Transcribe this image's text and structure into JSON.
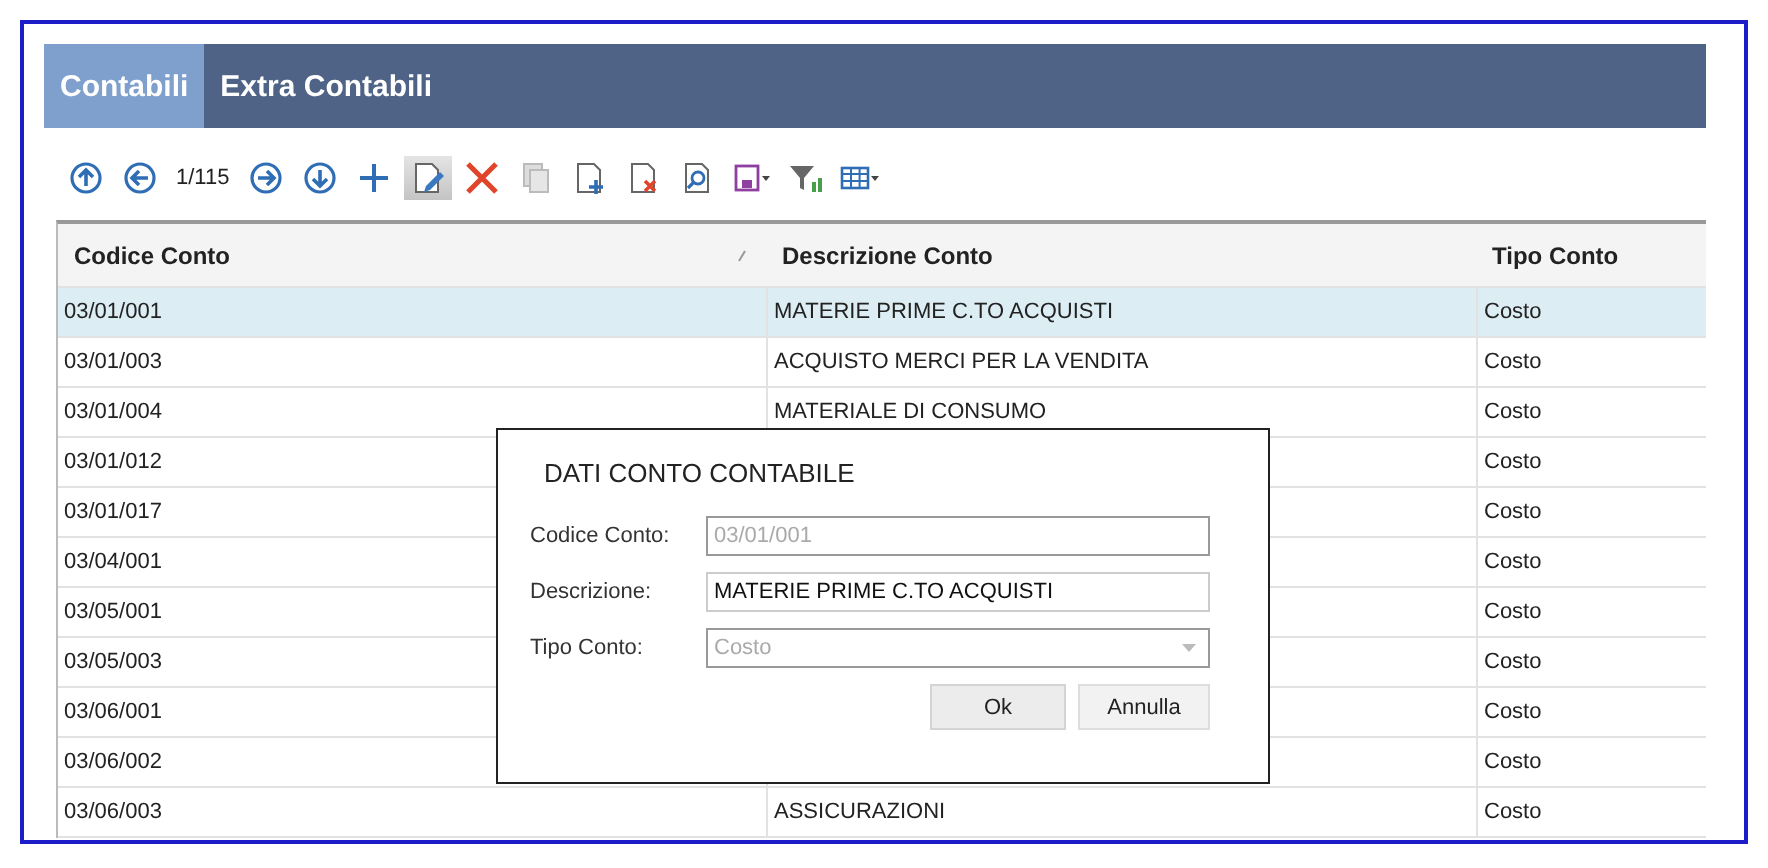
{
  "tabs": [
    {
      "label": "Contabili",
      "selected": true
    },
    {
      "label": "Extra Contabili",
      "selected": false
    }
  ],
  "toolbar": [
    {
      "kind": "first",
      "pressed": false
    },
    {
      "kind": "prev",
      "pressed": false
    },
    {
      "kind": "counter",
      "text": "1/115"
    },
    {
      "kind": "next",
      "pressed": false
    },
    {
      "kind": "last",
      "pressed": false
    },
    {
      "kind": "add",
      "pressed": false
    },
    {
      "kind": "edit",
      "pressed": true
    },
    {
      "kind": "delete",
      "pressed": false
    },
    {
      "kind": "copy",
      "pressed": false
    },
    {
      "kind": "new-doc",
      "pressed": false
    },
    {
      "kind": "remove-doc",
      "pressed": false
    },
    {
      "kind": "find-doc",
      "pressed": false
    },
    {
      "kind": "save",
      "pressed": false
    },
    {
      "kind": "filter",
      "pressed": false
    },
    {
      "kind": "grid",
      "pressed": false
    }
  ],
  "table": {
    "columns": [
      "Codice Conto",
      "Descrizione Conto",
      "Tipo Conto"
    ],
    "rows": [
      {
        "code": "03/01/001",
        "description": "MATERIE PRIME C.TO ACQUISTI",
        "type": "Costo",
        "selected": true
      },
      {
        "code": "03/01/003",
        "description": "ACQUISTO MERCI PER LA VENDITA",
        "type": "Costo",
        "selected": false
      },
      {
        "code": "03/01/004",
        "description": "MATERIALE DI CONSUMO",
        "type": "Costo",
        "selected": false
      },
      {
        "code": "03/01/012",
        "type": "Costo",
        "selected": false
      },
      {
        "code": "03/01/017",
        "type": "Costo",
        "selected": false
      },
      {
        "code": "03/04/001",
        "type": "Costo",
        "selected": false
      },
      {
        "code": "03/05/001",
        "type": "Costo",
        "selected": false
      },
      {
        "code": "03/05/003",
        "type": "Costo",
        "selected": false
      },
      {
        "code": "03/06/001",
        "type": "Costo",
        "selected": false
      },
      {
        "code": "03/06/002",
        "type": "Costo",
        "selected": false
      },
      {
        "code": "03/06/003",
        "description": "ASSICURAZIONI",
        "type": "Costo",
        "selected": false
      }
    ]
  },
  "dialog": {
    "title": "DATI CONTO CONTABILE",
    "fields": [
      {
        "label": "Codice Conto:",
        "value": "03/01/001",
        "kind": "text",
        "disabled": true
      },
      {
        "label": "Descrizione:",
        "value": "MATERIE PRIME C.TO ACQUISTI",
        "kind": "text",
        "disabled": false
      },
      {
        "label": "Tipo Conto:",
        "value": "Costo",
        "kind": "select",
        "disabled": true
      }
    ],
    "buttons": [
      "Ok",
      "Annulla"
    ]
  }
}
